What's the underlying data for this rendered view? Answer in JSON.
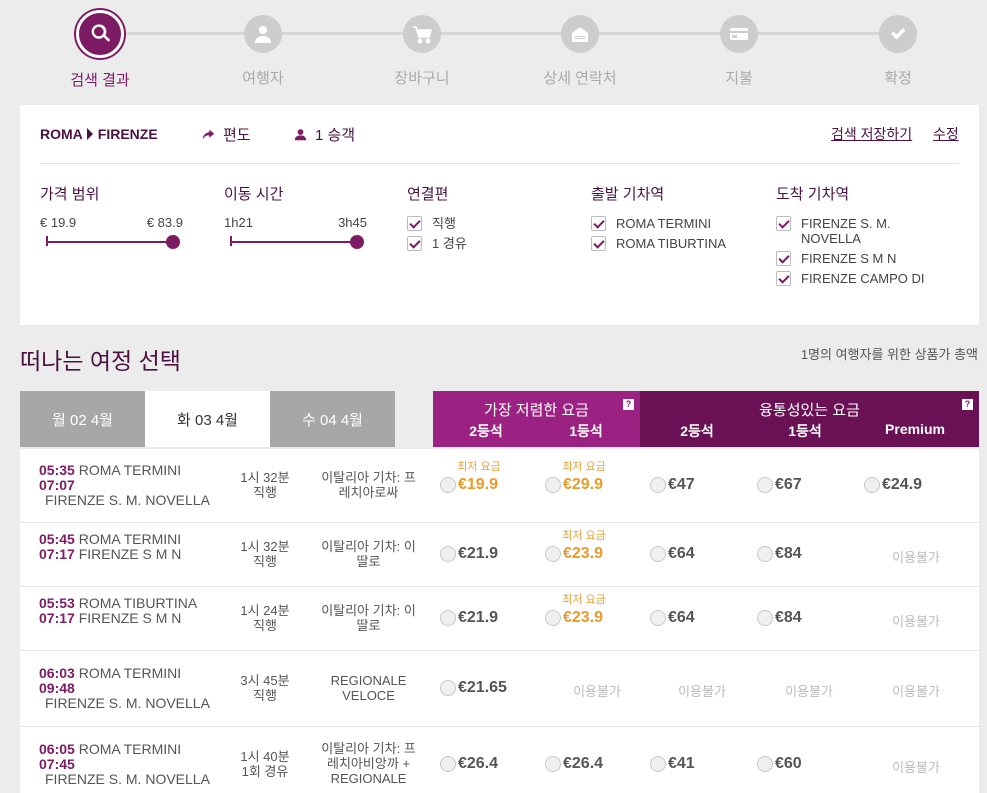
{
  "steps": [
    {
      "label": "검색 결과",
      "icon": "search-icon",
      "active": true
    },
    {
      "label": "여행자",
      "icon": "person-icon",
      "active": false
    },
    {
      "label": "장바구니",
      "icon": "cart-icon",
      "active": false
    },
    {
      "label": "상세 연락처",
      "icon": "contact-icon",
      "active": false
    },
    {
      "label": "지불",
      "icon": "card-icon",
      "active": false
    },
    {
      "label": "확정",
      "icon": "check-icon",
      "active": false
    }
  ],
  "summary": {
    "origin": "ROMA",
    "destination": "FIRENZE",
    "trip_type": "편도",
    "passengers": "1 승객",
    "save_search": "검색 저장하기",
    "edit": "수정"
  },
  "filters": {
    "price": {
      "title": "가격 범위",
      "min": "€ 19.9",
      "max": "€ 83.9"
    },
    "duration": {
      "title": "이동 시간",
      "min": "1h21",
      "max": "3h45"
    },
    "connections": {
      "title": "연결편",
      "options": [
        "직행",
        "1 경유"
      ]
    },
    "departure_station": {
      "title": "출발 기차역",
      "options": [
        "ROMA TERMINI",
        "ROMA TIBURTINA"
      ]
    },
    "arrival_station": {
      "title": "도착 기차역",
      "options": [
        "FIRENZE S. M. NOVELLA",
        "FIRENZE S M N",
        "FIRENZE CAMPO DI"
      ]
    }
  },
  "results": {
    "title": "떠나는 여정 선택",
    "price_note": "1명의 여행자를 위한 상품가 총액"
  },
  "date_tabs": [
    {
      "label": "월 02 4월",
      "active": false
    },
    {
      "label": "화 03 4월",
      "active": true
    },
    {
      "label": "수 04 4월",
      "active": false
    }
  ],
  "fare_groups": {
    "cheapest": {
      "title": "가장 저렴한 요금",
      "cols": [
        "2등석",
        "1등석"
      ],
      "help": "?"
    },
    "flexible": {
      "title": "융통성있는 요금",
      "cols": [
        "2등석",
        "1등석",
        "Premium"
      ],
      "help": "?"
    }
  },
  "labels": {
    "lowest": "최저 요금",
    "unavailable": "이용불가"
  },
  "colors": {
    "brand": "#7d1a64",
    "brand_light": "#9b2182",
    "brand_dark": "#6a1055",
    "lowest_price": "#e89a2c"
  },
  "trains": [
    {
      "dep_time": "05:35",
      "dep_station": "ROMA TERMINI",
      "arr_time": "07:07",
      "arr_station": "FIRENZE S. M. NOVELLA",
      "duration": "1시 32분",
      "stops": "직행",
      "train": "이탈리아 기차: 프레치아로싸",
      "fares": [
        {
          "price": "€19.9",
          "low": true
        },
        {
          "price": "€29.9",
          "low": true
        },
        {
          "price": "€47"
        },
        {
          "price": "€67"
        },
        {
          "price": "€24.9"
        }
      ]
    },
    {
      "dep_time": "05:45",
      "dep_station": "ROMA TERMINI",
      "arr_time": "07:17",
      "arr_station": "FIRENZE S M N",
      "duration": "1시 32분",
      "stops": "직행",
      "train": "이탈리아 기차: 이딸로",
      "fares": [
        {
          "price": "€21.9"
        },
        {
          "price": "€23.9",
          "low": true
        },
        {
          "price": "€64"
        },
        {
          "price": "€84"
        },
        {
          "na": true
        }
      ]
    },
    {
      "dep_time": "05:53",
      "dep_station": "ROMA TIBURTINA",
      "arr_time": "07:17",
      "arr_station": "FIRENZE S M N",
      "duration": "1시 24분",
      "stops": "직행",
      "train": "이탈리아 기차: 이딸로",
      "fares": [
        {
          "price": "€21.9"
        },
        {
          "price": "€23.9",
          "low": true
        },
        {
          "price": "€64"
        },
        {
          "price": "€84"
        },
        {
          "na": true
        }
      ]
    },
    {
      "dep_time": "06:03",
      "dep_station": "ROMA TERMINI",
      "arr_time": "09:48",
      "arr_station": "FIRENZE S. M. NOVELLA",
      "duration": "3시 45분",
      "stops": "직행",
      "train": "REGIONALE VELOCE",
      "fares": [
        {
          "price": "€21.65"
        },
        {
          "na": true
        },
        {
          "na": true
        },
        {
          "na": true
        },
        {
          "na": true
        }
      ]
    },
    {
      "dep_time": "06:05",
      "dep_station": "ROMA TERMINI",
      "arr_time": "07:45",
      "arr_station": "FIRENZE S. M. NOVELLA",
      "duration": "1시 40분",
      "stops": "1회 경유",
      "train": "이탈리아 기차: 프레치아비앙까 + REGIONALE",
      "fares": [
        {
          "price": "€26.4"
        },
        {
          "price": "€26.4"
        },
        {
          "price": "€41"
        },
        {
          "price": "€60"
        },
        {
          "na": true
        }
      ]
    }
  ]
}
